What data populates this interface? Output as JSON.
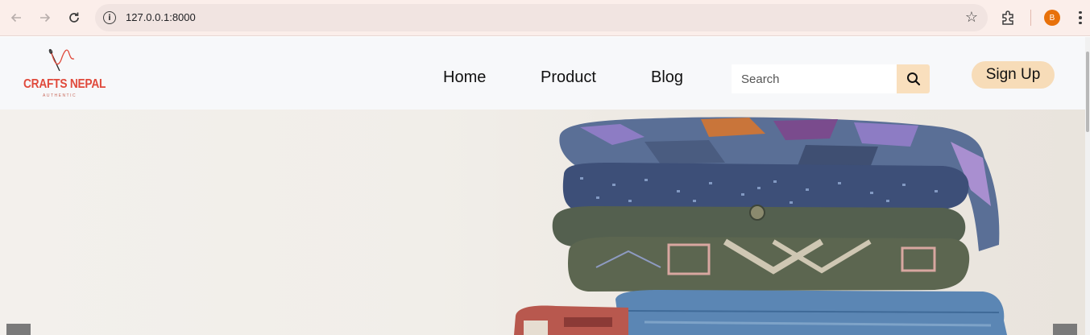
{
  "browser": {
    "url": "127.0.0.1:8000",
    "profile_initial": "B"
  },
  "site": {
    "logo_text": "CRAFTS NEPAL",
    "logo_subtext": "AUTHENTIC"
  },
  "nav": {
    "items": [
      {
        "label": "Home"
      },
      {
        "label": "Product"
      },
      {
        "label": "Blog"
      }
    ]
  },
  "search": {
    "placeholder": "Search"
  },
  "auth": {
    "signup_label": "Sign Up"
  },
  "colors": {
    "brand_red": "#e04a3c",
    "accent_peach": "#f7dcb8",
    "header_bg": "#f7f8fa"
  },
  "icons": {
    "back": "arrow-left-icon",
    "forward": "arrow-right-icon",
    "reload": "reload-icon",
    "site_info": "info-icon",
    "bookmark": "star-icon",
    "extensions": "puzzle-icon",
    "menu": "kebab-menu-icon",
    "search": "search-icon",
    "logo": "needle-thread-icon"
  }
}
